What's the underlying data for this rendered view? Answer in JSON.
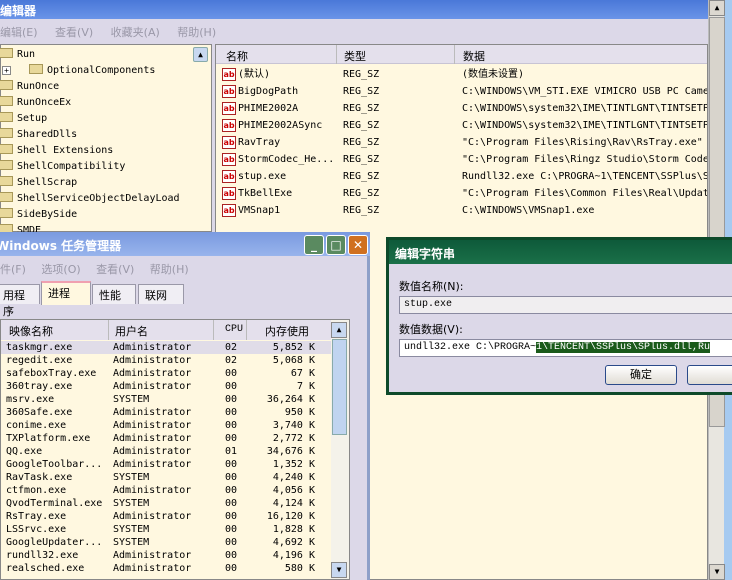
{
  "regedit": {
    "title": "编辑器",
    "menu": [
      "编辑(E)",
      "查看(V)",
      "收藏夹(A)",
      "帮助(H)"
    ],
    "tree": [
      "Run",
      "OptionalComponents",
      "RunOnce",
      "RunOnceEx",
      "Setup",
      "SharedDlls",
      "Shell Extensions",
      "ShellCompatibility",
      "ShellScrap",
      "ShellServiceObjectDelayLoad",
      "SideBySide",
      "SMDE"
    ],
    "columns": [
      "名称",
      "类型",
      "数据"
    ],
    "values": [
      {
        "name": "(默认)",
        "type": "REG_SZ",
        "data": "(数值未设置)"
      },
      {
        "name": "BigDogPath",
        "type": "REG_SZ",
        "data": "C:\\WINDOWS\\VM_STI.EXE VIMICRO USB PC Came"
      },
      {
        "name": "PHIME2002A",
        "type": "REG_SZ",
        "data": "C:\\WINDOWS\\system32\\IME\\TINTLGNT\\TINTSETP"
      },
      {
        "name": "PHIME2002ASync",
        "type": "REG_SZ",
        "data": "C:\\WINDOWS\\system32\\IME\\TINTLGNT\\TINTSETP"
      },
      {
        "name": "RavTray",
        "type": "REG_SZ",
        "data": "\"C:\\Program Files\\Rising\\Rav\\RsTray.exe\""
      },
      {
        "name": "StormCodec_He...",
        "type": "REG_SZ",
        "data": "\"C:\\Program Files\\Ringz Studio\\Storm Code"
      },
      {
        "name": "stup.exe",
        "type": "REG_SZ",
        "data": "Rundll32.exe C:\\PROGRA~1\\TENCENT\\SSPlus\\S"
      },
      {
        "name": "TkBellExe",
        "type": "REG_SZ",
        "data": "\"C:\\Program Files\\Common Files\\Real\\Updat"
      },
      {
        "name": "VMSnap1",
        "type": "REG_SZ",
        "data": "C:\\WINDOWS\\VMSnap1.exe"
      }
    ]
  },
  "taskmgr": {
    "title": "Windows 任务管理器",
    "menu": [
      "件(F)",
      "选项(O)",
      "查看(V)",
      "帮助(H)"
    ],
    "tabs": [
      "用程序",
      "进程",
      "性能",
      "联网"
    ],
    "active_tab": "进程",
    "columns": [
      "映像名称",
      "用户名",
      "CPU",
      "内存使用"
    ],
    "processes": [
      [
        "taskmgr.exe",
        "Administrator",
        "02",
        "5,852 K"
      ],
      [
        "regedit.exe",
        "Administrator",
        "02",
        "5,068 K"
      ],
      [
        "safeboxTray.exe",
        "Administrator",
        "00",
        "67 K"
      ],
      [
        "360tray.exe",
        "Administrator",
        "00",
        "7 K"
      ],
      [
        "msrv.exe",
        "SYSTEM",
        "00",
        "36,264 K"
      ],
      [
        "360Safe.exe",
        "Administrator",
        "00",
        "950 K"
      ],
      [
        "conime.exe",
        "Administrator",
        "00",
        "3,740 K"
      ],
      [
        "TXPlatform.exe",
        "Administrator",
        "00",
        "2,772 K"
      ],
      [
        "QQ.exe",
        "Administrator",
        "01",
        "34,676 K"
      ],
      [
        "GoogleToolbar...",
        "Administrator",
        "00",
        "1,352 K"
      ],
      [
        "RavTask.exe",
        "SYSTEM",
        "00",
        "4,240 K"
      ],
      [
        "ctfmon.exe",
        "Administrator",
        "00",
        "4,056 K"
      ],
      [
        "QvodTerminal.exe",
        "SYSTEM",
        "00",
        "4,124 K"
      ],
      [
        "RsTray.exe",
        "Administrator",
        "00",
        "16,120 K"
      ],
      [
        "LSSrvc.exe",
        "SYSTEM",
        "00",
        "1,828 K"
      ],
      [
        "GoogleUpdater...",
        "SYSTEM",
        "00",
        "4,692 K"
      ],
      [
        "rundll32.exe",
        "Administrator",
        "00",
        "4,196 K"
      ],
      [
        "realsched.exe",
        "Administrator",
        "00",
        "580 K"
      ]
    ]
  },
  "dialog": {
    "title": "编辑字符串",
    "name_label": "数值名称(N):",
    "name_value": "stup.exe",
    "data_label": "数值数据(V):",
    "data_unselected": "undll32.exe C:\\PROGRA~",
    "data_selected": "1\\TENCENT\\SSPlus\\SPlus.dll,Ru",
    "ok": "确定"
  }
}
